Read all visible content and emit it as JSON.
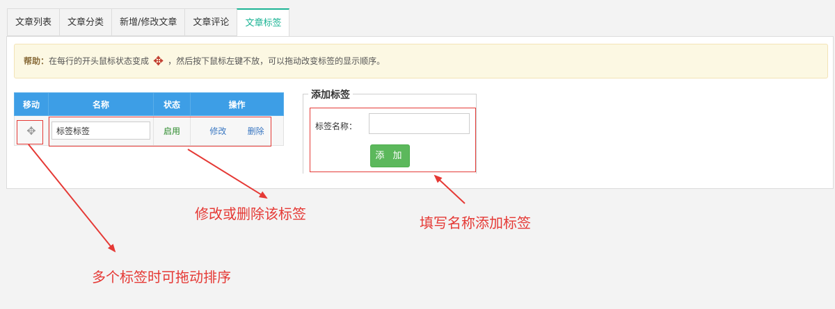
{
  "tabs": [
    {
      "label": "文章列表",
      "active": false
    },
    {
      "label": "文章分类",
      "active": false
    },
    {
      "label": "新增/修改文章",
      "active": false
    },
    {
      "label": "文章评论",
      "active": false
    },
    {
      "label": "文章标签",
      "active": true
    }
  ],
  "help": {
    "prefix": "帮助：",
    "text_before": "在每行的开头鼠标状态变成",
    "text_after": "，然后按下鼠标左键不放，可以拖动改变标签的显示顺序。"
  },
  "table": {
    "headers": [
      "移动",
      "名称",
      "状态",
      "操作"
    ],
    "rows": [
      {
        "name": "标签标签",
        "status": "启用",
        "edit": "修改",
        "delete": "删除"
      }
    ]
  },
  "add_form": {
    "legend": "添加标签",
    "label": "标签名称：",
    "value": "",
    "button": "添 加"
  },
  "annotations": {
    "edit_delete": "修改或删除该标签",
    "fill_add": "填写名称添加标签",
    "drag_sort": "多个标签时可拖动排序"
  },
  "colors": {
    "accent": "#1ab394",
    "table_header": "#3d9ee6",
    "annotation": "#e53935",
    "button": "#5cb85c"
  }
}
